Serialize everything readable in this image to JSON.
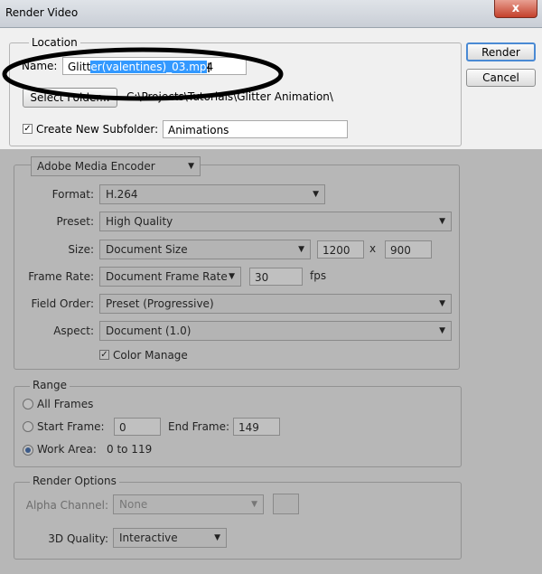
{
  "window": {
    "title": "Render Video",
    "close_glyph": "x"
  },
  "location": {
    "legend": "Location",
    "name_label": "Name:",
    "name_value_pre": "Glitt",
    "name_value_selected": "er(valentines)_03.mp",
    "name_value_post": "4",
    "select_folder_label": "Select Folder...",
    "folder_path": "C:\\Projects\\Tutorials\\Glitter Animation\\",
    "create_subfolder_label": "Create New Subfolder:",
    "create_subfolder_checked": true,
    "subfolder_value": "Animations"
  },
  "buttons": {
    "render": "Render",
    "cancel": "Cancel"
  },
  "encoder": {
    "encoder_value": "Adobe Media Encoder",
    "format_label": "Format:",
    "format_value": "H.264",
    "preset_label": "Preset:",
    "preset_value": "High Quality",
    "size_label": "Size:",
    "size_value": "Document Size",
    "width": "1200",
    "x_sep": "x",
    "height": "900",
    "frame_rate_label": "Frame Rate:",
    "frame_rate_value": "Document Frame Rate",
    "fps_value": "30",
    "fps_unit": "fps",
    "field_order_label": "Field Order:",
    "field_order_value": "Preset (Progressive)",
    "aspect_label": "Aspect:",
    "aspect_value": "Document (1.0)",
    "color_manage_label": "Color Manage",
    "color_manage_checked": true
  },
  "range": {
    "legend": "Range",
    "all_frames_label": "All Frames",
    "start_frame_label": "Start Frame:",
    "start_frame_value": "0",
    "end_frame_label": "End Frame:",
    "end_frame_value": "149",
    "work_area_label": "Work Area:",
    "work_area_value": "0 to 119",
    "selected": "Work Area"
  },
  "render_options": {
    "legend": "Render Options",
    "alpha_label": "Alpha Channel:",
    "alpha_value": "None",
    "quality_label": "3D Quality:",
    "quality_value": "Interactive"
  },
  "icons": {
    "dropdown": "chevron-down-icon",
    "checkmark": "checkmark-icon",
    "text_cursor": "i-beam-cursor-icon"
  },
  "colors": {
    "selection": "#3399ff",
    "annotation_ellipse": "#000000",
    "overlay": "#5a5a5a"
  }
}
